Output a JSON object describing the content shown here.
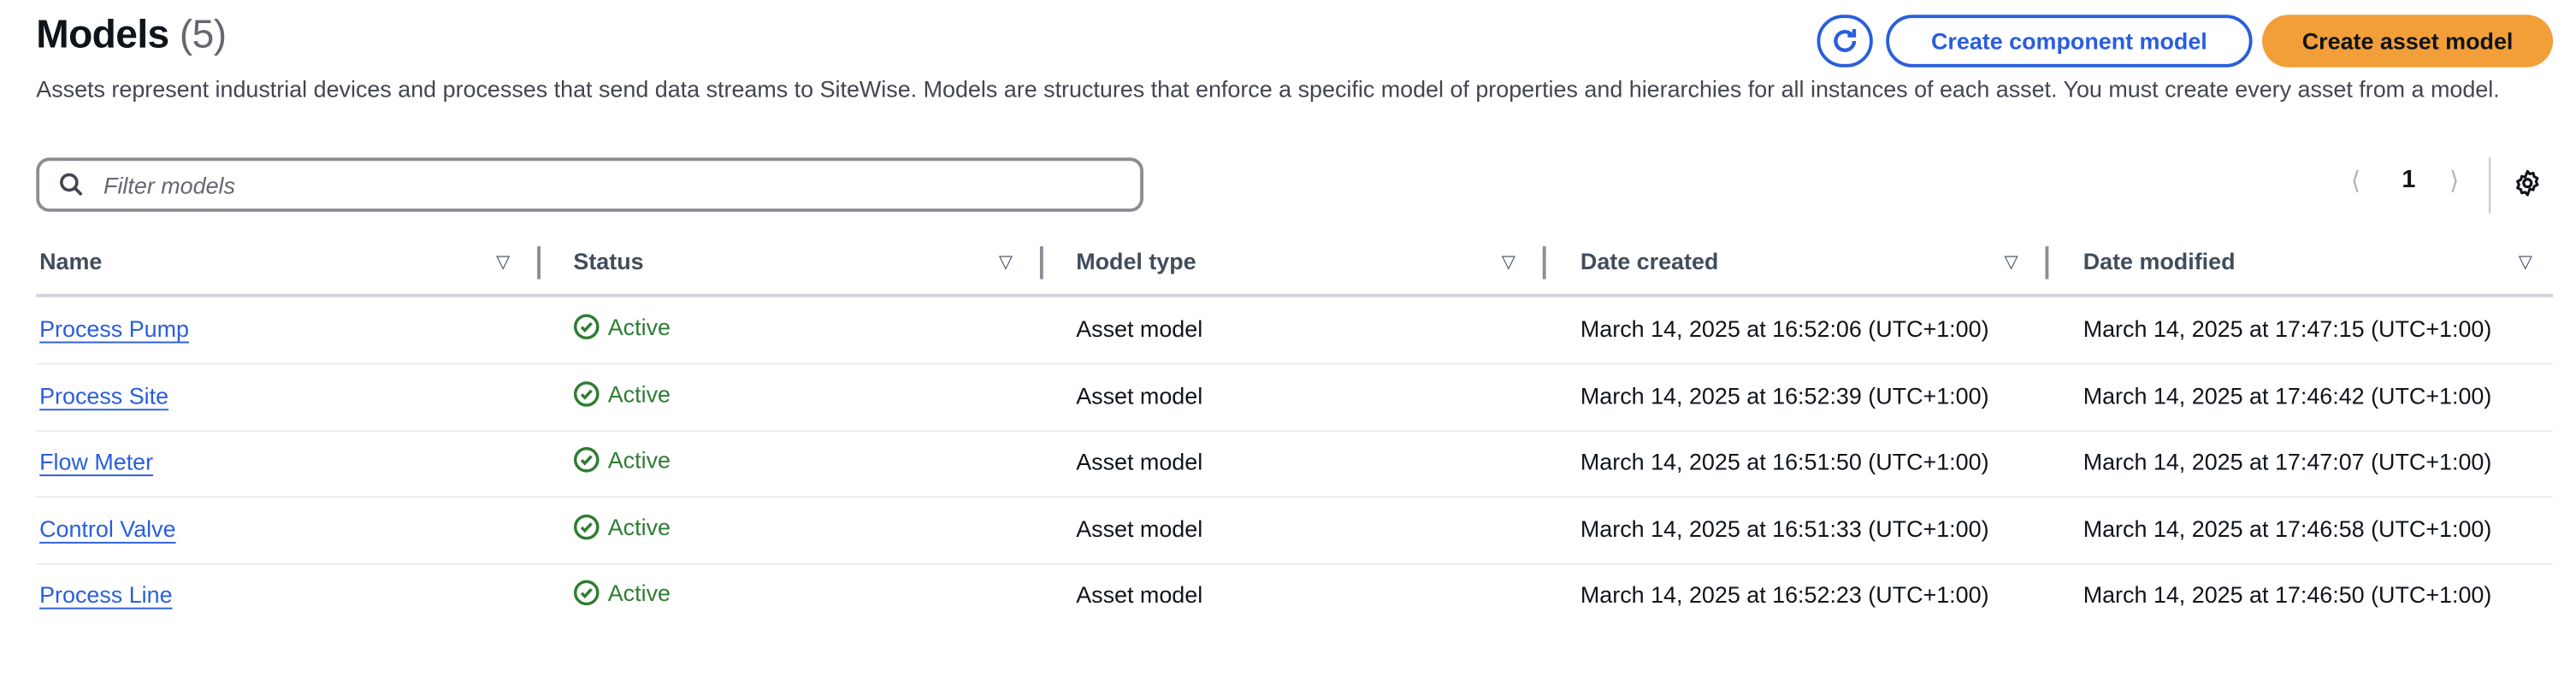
{
  "header": {
    "title": "Models",
    "count": "(5)",
    "description": "Assets represent industrial devices and processes that send data streams to SiteWise. Models are structures that enforce a specific model of properties and hierarchies for all instances of each asset. You must create every asset from a model.",
    "refresh_icon": "refresh-icon",
    "create_component_label": "Create component model",
    "create_asset_label": "Create asset model"
  },
  "colors": {
    "accent": "#295edd",
    "primary_button": "#f29f39",
    "status_active": "#2e7d32"
  },
  "filter": {
    "placeholder": "Filter models",
    "value": ""
  },
  "pagination": {
    "current_page": "1"
  },
  "table": {
    "columns": [
      "Name",
      "Status",
      "Model type",
      "Date created",
      "Date modified"
    ],
    "rows": [
      {
        "name": "Process Pump",
        "status": "Active",
        "type": "Asset model",
        "created": "March 14, 2025 at 16:52:06 (UTC+1:00)",
        "modified": "March 14, 2025 at 17:47:15 (UTC+1:00)"
      },
      {
        "name": "Process Site",
        "status": "Active",
        "type": "Asset model",
        "created": "March 14, 2025 at 16:52:39 (UTC+1:00)",
        "modified": "March 14, 2025 at 17:46:42 (UTC+1:00)"
      },
      {
        "name": "Flow Meter",
        "status": "Active",
        "type": "Asset model",
        "created": "March 14, 2025 at 16:51:50 (UTC+1:00)",
        "modified": "March 14, 2025 at 17:47:07 (UTC+1:00)"
      },
      {
        "name": "Control Valve",
        "status": "Active",
        "type": "Asset model",
        "created": "March 14, 2025 at 16:51:33 (UTC+1:00)",
        "modified": "March 14, 2025 at 17:46:58 (UTC+1:00)"
      },
      {
        "name": "Process Line",
        "status": "Active",
        "type": "Asset model",
        "created": "March 14, 2025 at 16:52:23 (UTC+1:00)",
        "modified": "March 14, 2025 at 17:46:50 (UTC+1:00)"
      }
    ]
  }
}
